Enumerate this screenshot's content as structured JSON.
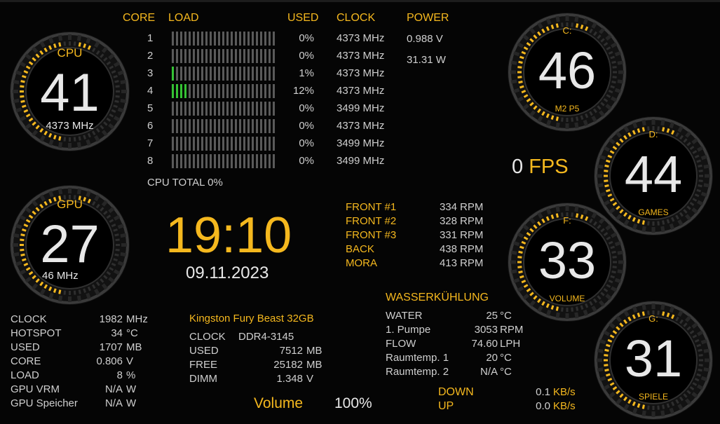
{
  "cpu": {
    "gauge": {
      "title": "CPU",
      "value": "41",
      "sub": "4373 MHz"
    },
    "headers": {
      "core": "CORE",
      "load": "LOAD",
      "used": "USED",
      "clock": "CLOCK",
      "power": "POWER"
    },
    "cores": [
      {
        "n": "1",
        "load": 0,
        "used": "0%",
        "clock": "4373 MHz"
      },
      {
        "n": "2",
        "load": 0,
        "used": "0%",
        "clock": "4373 MHz"
      },
      {
        "n": "3",
        "load": 1,
        "used": "1%",
        "clock": "4373 MHz"
      },
      {
        "n": "4",
        "load": 12,
        "used": "12%",
        "clock": "4373 MHz"
      },
      {
        "n": "5",
        "load": 0,
        "used": "0%",
        "clock": "3499 MHz"
      },
      {
        "n": "6",
        "load": 0,
        "used": "0%",
        "clock": "4373 MHz"
      },
      {
        "n": "7",
        "load": 0,
        "used": "0%",
        "clock": "3499 MHz"
      },
      {
        "n": "8",
        "load": 0,
        "used": "0%",
        "clock": "3499 MHz"
      }
    ],
    "power_voltage": "0.988 V",
    "power_watt": "31.31 W",
    "total": "CPU TOTAL 0%"
  },
  "gpu": {
    "gauge": {
      "title": "GPU",
      "value": "27",
      "sub": "46 MHz"
    },
    "stats": [
      {
        "label": "CLOCK",
        "value": "1982",
        "unit": "MHz"
      },
      {
        "label": "HOTSPOT",
        "value": "34",
        "unit": "°C"
      },
      {
        "label": "USED",
        "value": "1707",
        "unit": "MB"
      },
      {
        "label": "CORE",
        "value": "0.806",
        "unit": "V"
      },
      {
        "label": "LOAD",
        "value": "8",
        "unit": "%"
      },
      {
        "label": "GPU VRM",
        "value": "N/A",
        "unit": "W"
      },
      {
        "label": "GPU Speicher",
        "value": "N/A",
        "unit": "W"
      }
    ]
  },
  "clock": {
    "time": "19:10",
    "date": "09.11.2023"
  },
  "fans": [
    {
      "label": "FRONT #1",
      "value": "334",
      "unit": "RPM"
    },
    {
      "label": "FRONT #2",
      "value": "328",
      "unit": "RPM"
    },
    {
      "label": "FRONT #3",
      "value": "331",
      "unit": "RPM"
    },
    {
      "label": "BACK",
      "value": "438",
      "unit": "RPM"
    },
    {
      "label": "MORA",
      "value": "413",
      "unit": "RPM"
    }
  ],
  "ram": {
    "title": "Kingston Fury Beast 32GB",
    "stats": [
      {
        "label": "CLOCK",
        "value": "DDR4-3145",
        "unit": ""
      },
      {
        "label": "USED",
        "value": "7512",
        "unit": "MB"
      },
      {
        "label": "FREE",
        "value": "25182",
        "unit": "MB"
      },
      {
        "label": "DIMM",
        "value": "1.348",
        "unit": "V"
      }
    ]
  },
  "volume": {
    "label": "Volume",
    "value": "100%"
  },
  "water": {
    "title": "WASSERKÜHLUNG",
    "stats": [
      {
        "label": "WATER",
        "value": "25",
        "unit": "°C"
      },
      {
        "label": "1. Pumpe",
        "value": "3053",
        "unit": "RPM"
      },
      {
        "label": "FLOW",
        "value": "74.60",
        "unit": "LPH"
      },
      {
        "label": "Raumtemp. 1",
        "value": "20",
        "unit": "°C"
      },
      {
        "label": "Raumtemp. 2",
        "value": "N/A",
        "unit": "°C"
      }
    ]
  },
  "network": [
    {
      "label": "DOWN",
      "value": "0.1",
      "unit": "KB/s"
    },
    {
      "label": "UP",
      "value": "0.0",
      "unit": "KB/s"
    }
  ],
  "fps": {
    "value": "0",
    "unit": "FPS"
  },
  "drives": [
    {
      "letter": "C:",
      "value": "46",
      "name": "M2 P5"
    },
    {
      "letter": "D:",
      "value": "44",
      "name": "GAMES"
    },
    {
      "letter": "F:",
      "value": "33",
      "name": "VOLUME"
    },
    {
      "letter": "G:",
      "value": "31",
      "name": "SPIELE"
    }
  ],
  "colors": {
    "accent": "#f5b81e",
    "bar_on": "#35c234",
    "bar_off": "#5a5a5a",
    "text": "#e8e8e8"
  }
}
